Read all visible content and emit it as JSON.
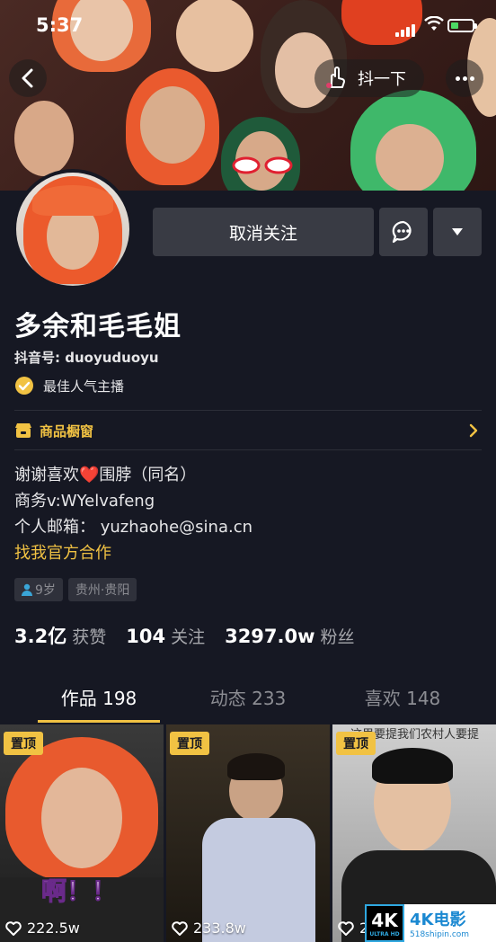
{
  "status_bar": {
    "time": "5:37"
  },
  "top_nav": {
    "shake_label": "抖一下"
  },
  "profile": {
    "nickname": "多余和毛毛姐",
    "douyin_id": "抖音号: duoyuduoyu",
    "badge": "最佳人气主播",
    "unfollow_label": "取消关注",
    "shop_label": "商品橱窗",
    "bio": {
      "line1_prefix": "谢谢喜欢",
      "heart": "❤️",
      "line1_suffix": "围脖（同名）",
      "line2": "商务v:WYelvafeng",
      "line3": "个人邮箱： yuzhaohe@sina.cn",
      "link": "找我官方合作"
    },
    "tags": {
      "age": "9岁",
      "location": "贵州·贵阳"
    },
    "stats": [
      {
        "num": "3.2亿",
        "label": "获赞"
      },
      {
        "num": "104",
        "label": "关注"
      },
      {
        "num": "3297.0w",
        "label": "粉丝"
      }
    ]
  },
  "tabs": [
    {
      "label": "作品 198"
    },
    {
      "label": "动态 233"
    },
    {
      "label": "喜欢 148"
    }
  ],
  "videos": [
    {
      "pin": "置顶",
      "likes": "222.5w",
      "caption": "啊！！"
    },
    {
      "pin": "置顶",
      "likes": "233.8w"
    },
    {
      "pin": "置顶",
      "likes": "2",
      "top_text": "这里要提我们农村人要提"
    }
  ],
  "watermark": {
    "badge": "4K",
    "badge_sub": "ULTRA HD",
    "title": "4K电影",
    "url": "518shipin.com"
  },
  "colors": {
    "background": "#161823",
    "accent": "#f1c243",
    "button": "#393b44"
  }
}
